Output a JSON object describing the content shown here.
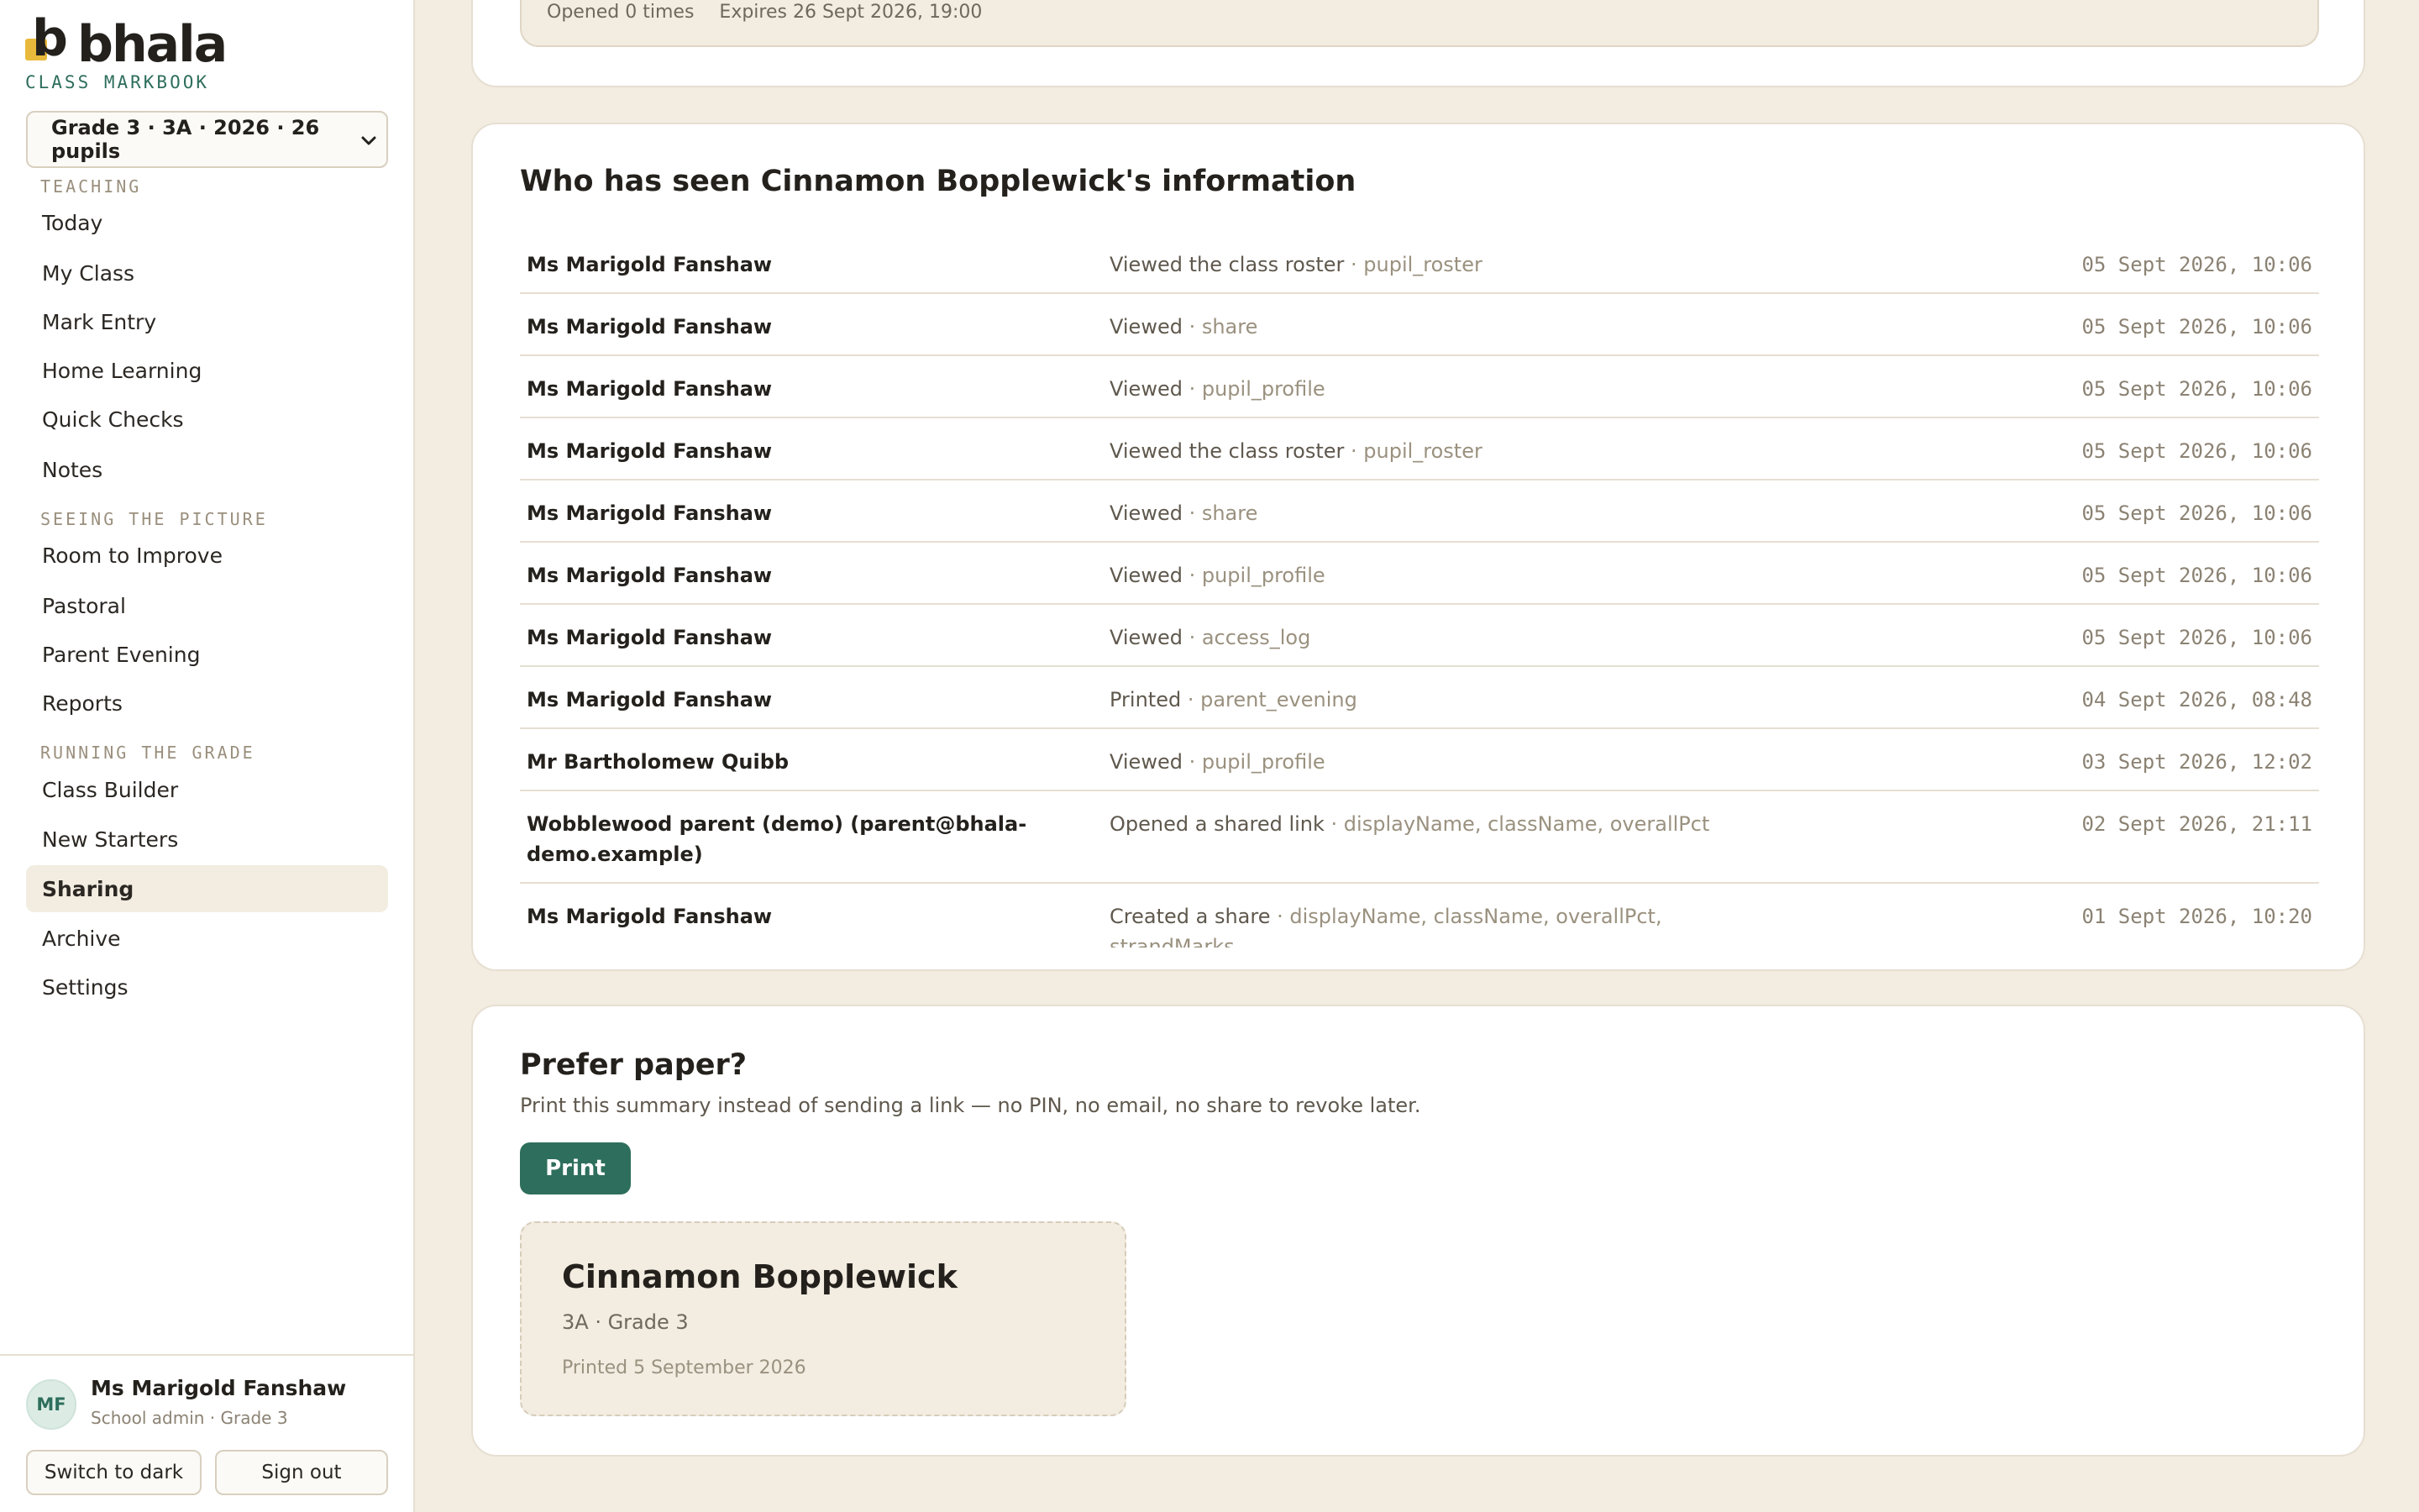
{
  "brand": {
    "mark": "b",
    "name": "bhala",
    "subtitle": "CLASS MARKBOOK"
  },
  "class_selector": {
    "value": "Grade 3 · 3A · 2026 · 26 pupils"
  },
  "nav": {
    "sections": [
      {
        "heading": "TEACHING",
        "items": [
          "Today",
          "My Class",
          "Mark Entry",
          "Home Learning",
          "Quick Checks",
          "Notes"
        ]
      },
      {
        "heading": "SEEING THE PICTURE",
        "items": [
          "Room to Improve",
          "Pastoral",
          "Parent Evening",
          "Reports"
        ]
      },
      {
        "heading": "RUNNING THE GRADE",
        "items": [
          "Class Builder",
          "New Starters",
          "Sharing",
          "Archive",
          "Settings"
        ]
      }
    ],
    "active": "Sharing"
  },
  "user": {
    "initials": "MF",
    "name": "Ms Marigold Fanshaw",
    "role": "School admin · Grade 3",
    "theme_button": "Switch to dark",
    "signout_button": "Sign out"
  },
  "share_link": {
    "opened": "Opened 0 times",
    "expires": "Expires 26 Sept 2026, 19:00"
  },
  "access_log": {
    "title": "Who has seen Cinnamon Bopplewick's information",
    "rows": [
      {
        "who": "Ms Marigold Fanshaw",
        "action": "Viewed the class roster",
        "context": "pupil_roster",
        "when": "05 Sept 2026, 10:06"
      },
      {
        "who": "Ms Marigold Fanshaw",
        "action": "Viewed",
        "context": "share",
        "when": "05 Sept 2026, 10:06"
      },
      {
        "who": "Ms Marigold Fanshaw",
        "action": "Viewed",
        "context": "pupil_profile",
        "when": "05 Sept 2026, 10:06"
      },
      {
        "who": "Ms Marigold Fanshaw",
        "action": "Viewed the class roster",
        "context": "pupil_roster",
        "when": "05 Sept 2026, 10:06"
      },
      {
        "who": "Ms Marigold Fanshaw",
        "action": "Viewed",
        "context": "share",
        "when": "05 Sept 2026, 10:06"
      },
      {
        "who": "Ms Marigold Fanshaw",
        "action": "Viewed",
        "context": "pupil_profile",
        "when": "05 Sept 2026, 10:06"
      },
      {
        "who": "Ms Marigold Fanshaw",
        "action": "Viewed",
        "context": "access_log",
        "when": "05 Sept 2026, 10:06"
      },
      {
        "who": "Ms Marigold Fanshaw",
        "action": "Printed",
        "context": "parent_evening",
        "when": "04 Sept 2026, 08:48"
      },
      {
        "who": "Mr Bartholomew Quibb",
        "action": "Viewed",
        "context": "pupil_profile",
        "when": "03 Sept 2026, 12:02"
      },
      {
        "who": "Wobblewood parent (demo) (parent@bhala-demo.example)",
        "action": "Opened a shared link",
        "context": "displayName, className, overallPct",
        "when": "02 Sept 2026, 21:11"
      },
      {
        "who": "Ms Marigold Fanshaw",
        "action": "Created a share",
        "context": "displayName, className, overallPct, strandMarks,",
        "when": "01 Sept 2026, 10:20"
      }
    ]
  },
  "paper": {
    "title": "Prefer paper?",
    "description": "Print this summary instead of sending a link — no PIN, no email, no share to revoke later.",
    "print_button": "Print",
    "preview": {
      "name": "Cinnamon Bopplewick",
      "class": "3A · Grade 3",
      "printed": "Printed 5 September 2026"
    }
  },
  "colors": {
    "accent": "#2e6e5c",
    "brand_yellow": "#e8b93a",
    "page_bg": "#f2ece1",
    "active_nav_bg": "#f2ece1"
  }
}
